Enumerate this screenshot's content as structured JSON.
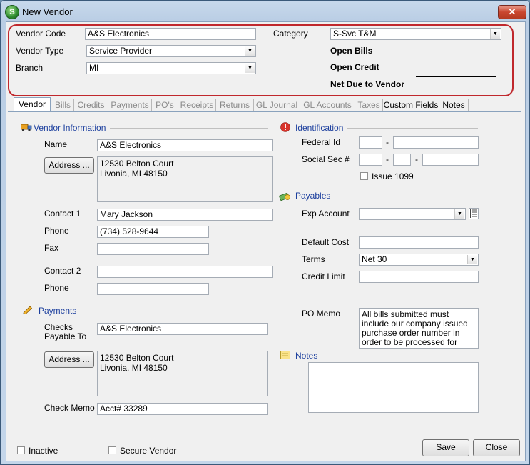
{
  "window": {
    "title": "New Vendor",
    "icon_letter": "S",
    "close_glyph": "✕"
  },
  "header": {
    "vendor_code_label": "Vendor Code",
    "vendor_code": "A&S Electronics",
    "vendor_type_label": "Vendor Type",
    "vendor_type": "Service Provider",
    "branch_label": "Branch",
    "branch": "MI",
    "category_label": "Category",
    "category": "S-Svc T&M",
    "open_bills_label": "Open Bills",
    "open_credit_label": "Open Credit",
    "net_due_label": "Net Due to Vendor"
  },
  "tabs": [
    "Vendor",
    "Bills",
    "Credits",
    "Payments",
    "PO's",
    "Receipts",
    "Returns",
    "GL Journal",
    "GL Accounts",
    "Taxes",
    "Custom Fields",
    "Notes"
  ],
  "vendor_info": {
    "section_title": "Vendor Information",
    "name_label": "Name",
    "name": "A&S Electronics",
    "address_button": "Address ...",
    "address": "12530 Belton Court\nLivonia, MI  48150",
    "contact1_label": "Contact 1",
    "contact1": "Mary Jackson",
    "phone_label": "Phone",
    "phone": "(734) 528-9644",
    "fax_label": "Fax",
    "fax": "",
    "contact2_label": "Contact 2",
    "contact2": "",
    "phone2_label": "Phone",
    "phone2": ""
  },
  "payments": {
    "section_title": "Payments",
    "checks_payable_label": "Checks\nPayable To",
    "checks_payable": "A&S Electronics",
    "address_button": "Address ...",
    "address": "12530 Belton Court\nLivonia, MI  48150",
    "check_memo_label": "Check Memo",
    "check_memo": "Acct# 33289"
  },
  "identification": {
    "section_title": "Identification",
    "federal_id_label": "Federal Id",
    "social_sec_label": "Social Sec #",
    "dash": "-",
    "issue_1099_label": "Issue 1099"
  },
  "payables": {
    "section_title": "Payables",
    "exp_account_label": "Exp Account",
    "exp_account": "",
    "default_cost_label": "Default Cost",
    "default_cost": "",
    "terms_label": "Terms",
    "terms": "Net 30",
    "credit_limit_label": "Credit Limit",
    "credit_limit": "",
    "po_memo_label": "PO Memo",
    "po_memo": "All bills submitted must include our company issued purchase order number in order to be processed for payment."
  },
  "notes": {
    "section_title": "Notes",
    "text": ""
  },
  "footer": {
    "inactive_label": "Inactive",
    "secure_vendor_label": "Secure Vendor",
    "save_button": "Save",
    "close_button": "Close"
  },
  "colors": {
    "accent": "#1c3f9e",
    "highlight_border": "#c0282d",
    "close_button": "#c9462f"
  }
}
